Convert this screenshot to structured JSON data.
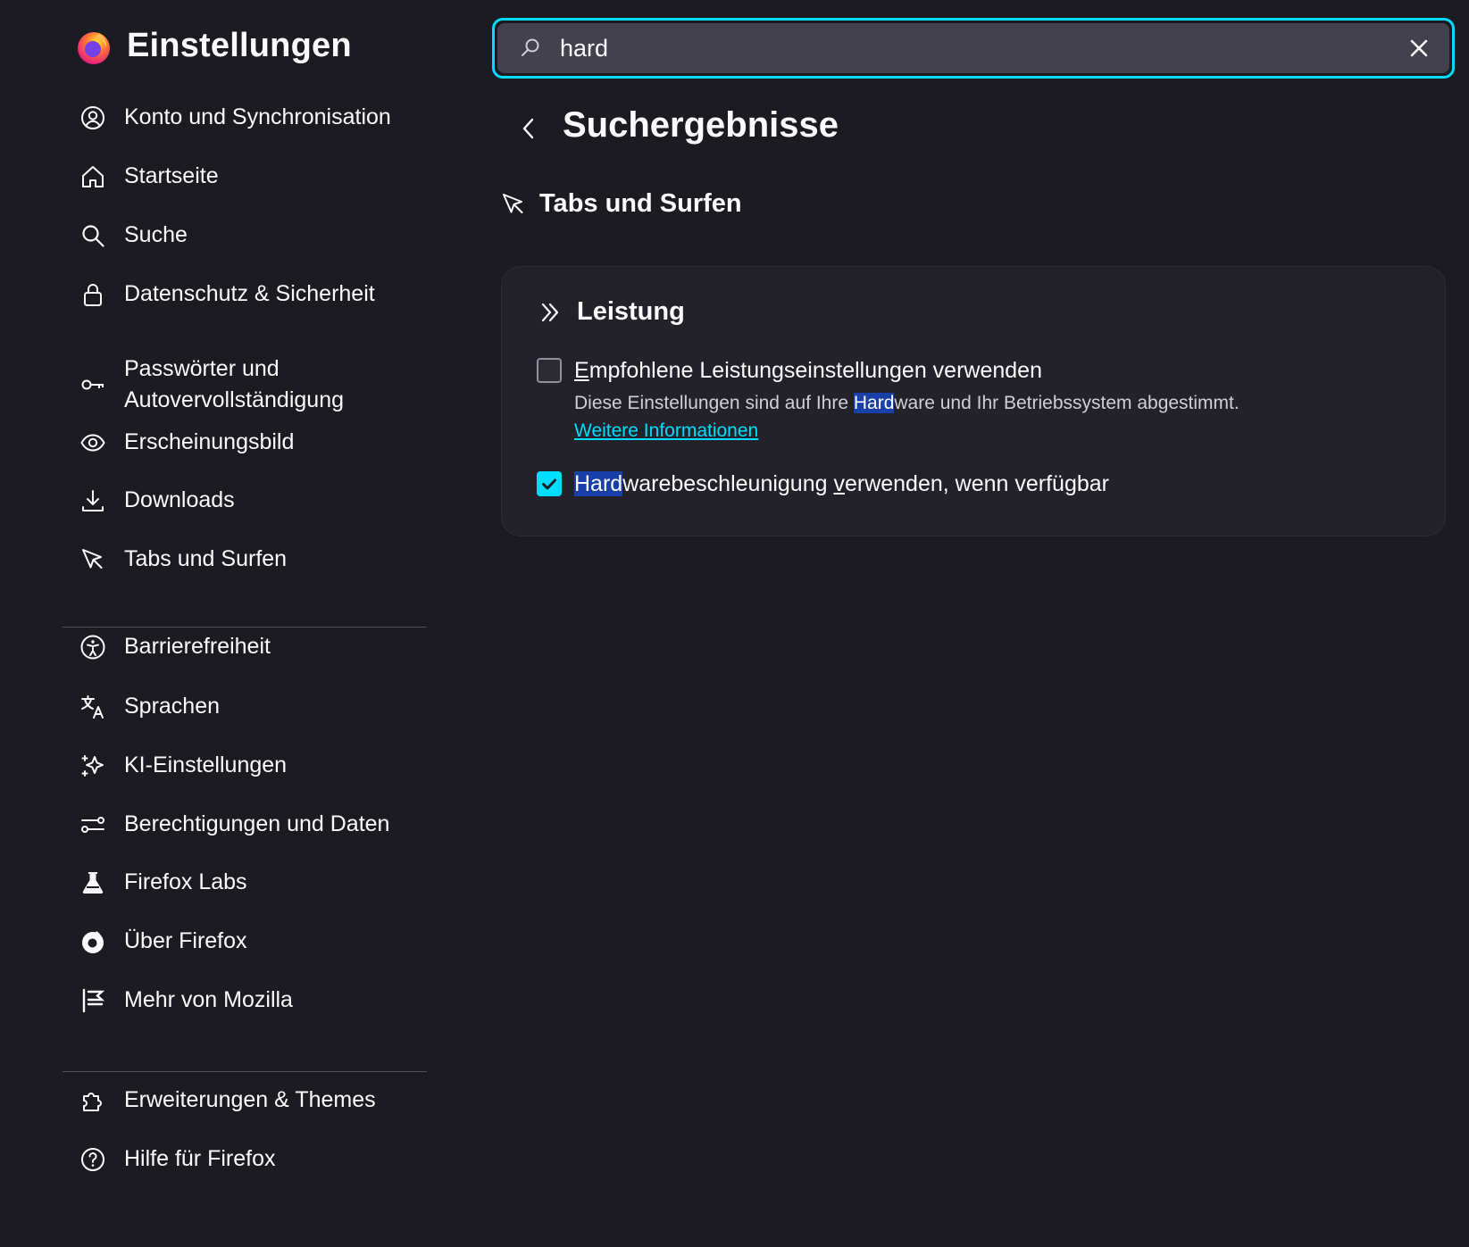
{
  "colors": {
    "background": "#1c1b22",
    "card": "#23222b",
    "accent": "#00ddff",
    "search_field": "#42414d",
    "highlight": "#1a3fa8",
    "divider": "#52525e"
  },
  "sidebar": {
    "title": "Einstellungen",
    "logo_icon": "firefox-logo",
    "items_group1": [
      {
        "label": "Konto und Synchronisation",
        "icon": "account-icon"
      },
      {
        "label": "Startseite",
        "icon": "home-icon"
      },
      {
        "label": "Suche",
        "icon": "search-icon"
      },
      {
        "label": "Datenschutz & Sicherheit",
        "icon": "lock-icon"
      },
      {
        "label": "Passwörter und Autovervollständigung",
        "label_line1": "Passwörter und",
        "label_line2": "Autovervollständigung",
        "icon": "key-icon"
      },
      {
        "label": "Erscheinungsbild",
        "icon": "eye-icon"
      },
      {
        "label": "Downloads",
        "icon": "download-icon"
      },
      {
        "label": "Tabs und Surfen",
        "icon": "cursor-icon"
      }
    ],
    "items_group2": [
      {
        "label": "Barrierefreiheit",
        "icon": "accessibility-icon"
      },
      {
        "label": "Sprachen",
        "icon": "translate-icon"
      },
      {
        "label": "KI-Einstellungen",
        "icon": "sparkle-icon"
      },
      {
        "label": "Berechtigungen und Daten",
        "icon": "sliders-icon"
      },
      {
        "label": "Firefox Labs",
        "icon": "flask-icon"
      },
      {
        "label": "Über Firefox",
        "icon": "firefox-mono-icon"
      },
      {
        "label": "Mehr von Mozilla",
        "icon": "mozilla-icon"
      }
    ],
    "items_group3": [
      {
        "label": "Erweiterungen & Themes",
        "icon": "puzzle-icon"
      },
      {
        "label": "Hilfe für Firefox",
        "icon": "help-icon"
      }
    ]
  },
  "search": {
    "value": "hard"
  },
  "results": {
    "title": "Suchergebnisse",
    "category": "Tabs und Surfen",
    "section": {
      "title": "Leistung",
      "option1": {
        "label_ak": "E",
        "label_rest": "mpfohlene Leistungseinstellungen verwenden",
        "checked": false,
        "desc_before": "Diese Einstellungen sind auf Ihre ",
        "desc_match": "Hard",
        "desc_after": "ware und Ihr Betriebssystem abgestimmt.",
        "link": "Weitere Informationen"
      },
      "option2": {
        "label_match": "Hard",
        "label_mid": "warebeschleunigung ",
        "label_ak": "v",
        "label_rest": "erwenden, wenn verfügbar",
        "checked": true
      }
    }
  }
}
